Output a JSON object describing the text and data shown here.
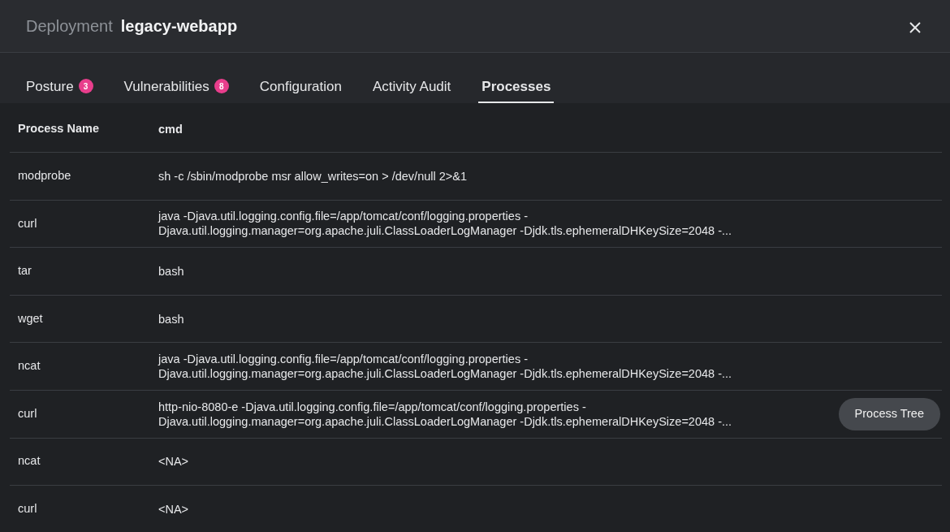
{
  "window": {
    "label": "Deployment",
    "title": "legacy-webapp"
  },
  "tabs": [
    {
      "label": "Posture",
      "count": "3",
      "selected": false
    },
    {
      "label": "Vulnerabilities",
      "count": "8",
      "selected": false
    },
    {
      "label": "Configuration",
      "selected": false
    },
    {
      "label": "Activity Audit",
      "selected": false
    },
    {
      "label": "Processes",
      "selected": true
    }
  ],
  "table": {
    "columns": [
      "Process Name",
      "cmd"
    ],
    "rows": [
      {
        "name": "modprobe",
        "cmd": [
          "sh -c /sbin/modprobe msr allow_writes=on > /dev/null 2>&1"
        ]
      },
      {
        "name": "curl",
        "cmd": [
          "java -Djava.util.logging.config.file=/app/tomcat/conf/logging.properties -",
          "Djava.util.logging.manager=org.apache.juli.ClassLoaderLogManager -Djdk.tls.ephemeralDHKeySize=2048 -..."
        ]
      },
      {
        "name": "tar",
        "cmd": [
          "bash"
        ]
      },
      {
        "name": "wget",
        "cmd": [
          "bash"
        ]
      },
      {
        "name": "ncat",
        "cmd": [
          "java -Djava.util.logging.config.file=/app/tomcat/conf/logging.properties -",
          "Djava.util.logging.manager=org.apache.juli.ClassLoaderLogManager -Djdk.tls.ephemeralDHKeySize=2048 -..."
        ]
      },
      {
        "name": "curl",
        "cmd": [
          "http-nio-8080-e -Djava.util.logging.config.file=/app/tomcat/conf/logging.properties -",
          "Djava.util.logging.manager=org.apache.juli.ClassLoaderLogManager -Djdk.tls.ephemeralDHKeySize=2048 -..."
        ],
        "action": "Process Tree"
      },
      {
        "name": "ncat",
        "cmd": [
          "<NA>"
        ]
      },
      {
        "name": "curl",
        "cmd": [
          "<NA>"
        ]
      }
    ]
  }
}
